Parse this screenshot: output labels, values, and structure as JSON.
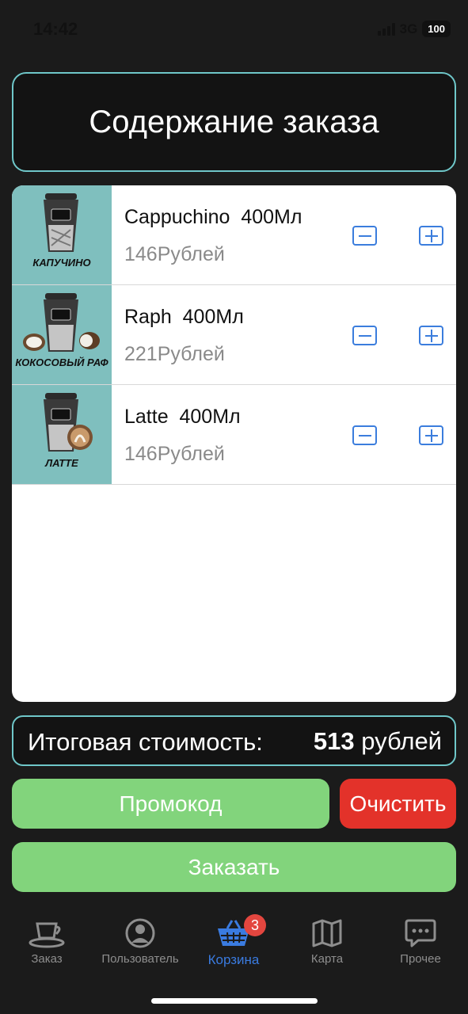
{
  "status_bar": {
    "time": "14:42",
    "network": "3G",
    "battery": "100"
  },
  "header": {
    "title": "Содержание заказа"
  },
  "items": [
    {
      "thumb_label": "КАПУЧИНО",
      "name": "Cappuchino  400Мл",
      "price": "146Рублей"
    },
    {
      "thumb_label": "КОКОСОВЫЙ РАФ",
      "name": "Raph  400Мл",
      "price": "221Рублей"
    },
    {
      "thumb_label": "ЛАТТЕ",
      "name": "Latte  400Мл",
      "price": "146Рублей"
    }
  ],
  "total": {
    "label": "Итоговая стоимость:",
    "amount": "513",
    "unit": "рублей"
  },
  "buttons": {
    "promo": "Промокод",
    "clear": "Очистить",
    "order": "Заказать"
  },
  "tabs": [
    {
      "label": "Заказ",
      "icon": "coffee-cup-icon",
      "active": false
    },
    {
      "label": "Пользователь",
      "icon": "user-icon",
      "active": false
    },
    {
      "label": "Корзина",
      "icon": "basket-icon",
      "active": true,
      "badge": "3"
    },
    {
      "label": "Карта",
      "icon": "map-icon",
      "active": false
    },
    {
      "label": "Прочее",
      "icon": "chat-icon",
      "active": false
    }
  ],
  "colors": {
    "accent": "#3a7be0",
    "green": "#82d47c",
    "red": "#e3322a",
    "border": "#6fc7c9",
    "thumb_bg": "#7fbfbe"
  }
}
